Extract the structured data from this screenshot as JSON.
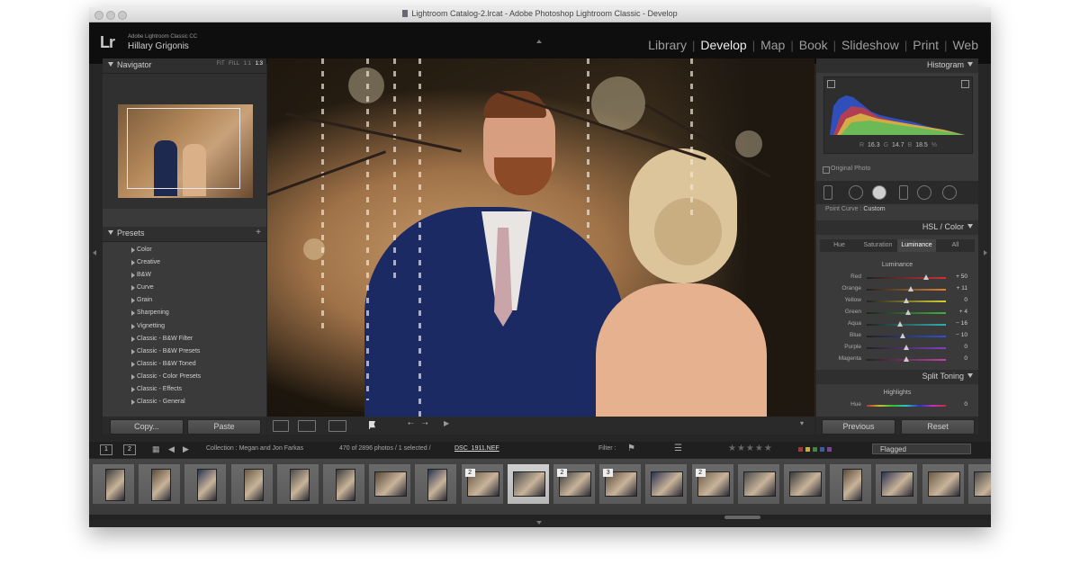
{
  "window": {
    "title": "Lightroom Catalog-2.lrcat - Adobe Photoshop Lightroom Classic - Develop"
  },
  "identity": {
    "logo": "Lr",
    "product": "Adobe Lightroom Classic CC",
    "user": "Hillary Grigonis"
  },
  "modules": [
    {
      "label": "Library",
      "active": false
    },
    {
      "label": "Develop",
      "active": true
    },
    {
      "label": "Map",
      "active": false
    },
    {
      "label": "Book",
      "active": false
    },
    {
      "label": "Slideshow",
      "active": false
    },
    {
      "label": "Print",
      "active": false
    },
    {
      "label": "Web",
      "active": false
    }
  ],
  "navigator": {
    "title": "Navigator",
    "zoom_options": [
      "FIT",
      "FILL",
      "1:1",
      "1:3"
    ],
    "zoom_selected": "1:3"
  },
  "presets": {
    "title": "Presets",
    "add": "+",
    "items": [
      "Color",
      "Creative",
      "B&W",
      "Curve",
      "Grain",
      "Sharpening",
      "Vignetting",
      "Classic - B&W Filter",
      "Classic - B&W Presets",
      "Classic - B&W Toned",
      "Classic - Color Presets",
      "Classic - Effects",
      "Classic - General"
    ]
  },
  "left_buttons": {
    "copy": "Copy...",
    "paste": "Paste"
  },
  "histogram": {
    "title": "Histogram",
    "r_label": "R",
    "r": "16.3",
    "g_label": "G",
    "g": "14.7",
    "b_label": "B",
    "b": "18.5",
    "unit": "%",
    "original_photo": "Original Photo"
  },
  "tone_curve": {
    "label": "Point Curve :",
    "value": "Custom"
  },
  "hsl": {
    "title": "HSL / Color",
    "tabs": [
      {
        "label": "Hue",
        "active": false
      },
      {
        "label": "Saturation",
        "active": false
      },
      {
        "label": "Luminance",
        "active": true
      },
      {
        "label": "All",
        "active": false
      }
    ],
    "section": "Luminance",
    "sliders": [
      {
        "name": "Red",
        "value": "+ 50",
        "level": 0.75
      },
      {
        "name": "Orange",
        "value": "+ 11",
        "level": 0.56
      },
      {
        "name": "Yellow",
        "value": "0",
        "level": 0.5
      },
      {
        "name": "Green",
        "value": "+ 4",
        "level": 0.52
      },
      {
        "name": "Aqua",
        "value": "− 16",
        "level": 0.42
      },
      {
        "name": "Blue",
        "value": "− 10",
        "level": 0.45
      },
      {
        "name": "Purple",
        "value": "0",
        "level": 0.5
      },
      {
        "name": "Magenta",
        "value": "0",
        "level": 0.5
      }
    ]
  },
  "split_toning": {
    "title": "Split Toning",
    "highlights": "Highlights",
    "hue_label": "Hue",
    "hue_value": "0"
  },
  "right_buttons": {
    "previous": "Previous",
    "reset": "Reset"
  },
  "filmstrip_bar": {
    "page1": "1",
    "page2": "2",
    "collection": "Collection : Megan and Jon Farkas",
    "count": "470 of 2896 photos / 1 selected /",
    "filename": "DSC_1911.NEF",
    "filter_label": "Filter :",
    "stars": "★★★★★",
    "filter_value": "Flagged",
    "label_colors": [
      "#b03030",
      "#c8b030",
      "#3a8a3a",
      "#3060b0",
      "#8040a0"
    ]
  },
  "filmstrip": {
    "thumbs": [
      {
        "orient": "portrait",
        "stack": ""
      },
      {
        "orient": "portrait",
        "stack": ""
      },
      {
        "orient": "portrait",
        "stack": ""
      },
      {
        "orient": "portrait",
        "stack": ""
      },
      {
        "orient": "portrait",
        "stack": ""
      },
      {
        "orient": "portrait",
        "stack": ""
      },
      {
        "orient": "landscape",
        "stack": ""
      },
      {
        "orient": "portrait",
        "stack": ""
      },
      {
        "orient": "landscape",
        "stack": "2"
      },
      {
        "orient": "landscape",
        "stack": "",
        "selected": true
      },
      {
        "orient": "landscape",
        "stack": "2"
      },
      {
        "orient": "landscape",
        "stack": "3"
      },
      {
        "orient": "landscape",
        "stack": ""
      },
      {
        "orient": "landscape",
        "stack": "2"
      },
      {
        "orient": "landscape",
        "stack": ""
      },
      {
        "orient": "landscape",
        "stack": ""
      },
      {
        "orient": "portrait",
        "stack": ""
      },
      {
        "orient": "landscape",
        "stack": ""
      },
      {
        "orient": "landscape",
        "stack": ""
      },
      {
        "orient": "landscape",
        "stack": ""
      }
    ]
  }
}
